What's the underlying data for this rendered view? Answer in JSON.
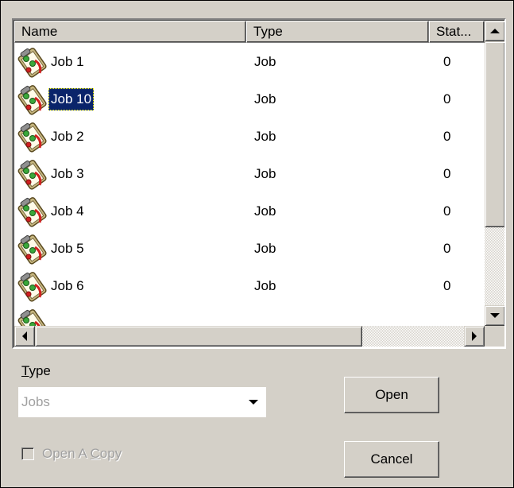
{
  "list": {
    "columns": [
      "Name",
      "Type",
      "Stat..."
    ],
    "rows": [
      {
        "name": "Job 1",
        "type": "Job",
        "status": "0",
        "selected": false
      },
      {
        "name": "Job 10",
        "type": "Job",
        "status": "0",
        "selected": true
      },
      {
        "name": "Job 2",
        "type": "Job",
        "status": "0",
        "selected": false
      },
      {
        "name": "Job 3",
        "type": "Job",
        "status": "0",
        "selected": false
      },
      {
        "name": "Job 4",
        "type": "Job",
        "status": "0",
        "selected": false
      },
      {
        "name": "Job 5",
        "type": "Job",
        "status": "0",
        "selected": false
      },
      {
        "name": "Job 6",
        "type": "Job",
        "status": "0",
        "selected": false
      }
    ],
    "row_icon": "job-clipboard-icon"
  },
  "type_field": {
    "label_accel": "T",
    "label_rest": "ype",
    "value": "Jobs"
  },
  "open_copy": {
    "label_pre": "Open A ",
    "label_accel": "C",
    "label_post": "opy",
    "checked": false
  },
  "buttons": {
    "open": "Open",
    "cancel": "Cancel"
  },
  "colors": {
    "dialog_bg": "#d4d0c8",
    "selection": "#0a246a",
    "disabled_text": "#a0a0a0"
  }
}
